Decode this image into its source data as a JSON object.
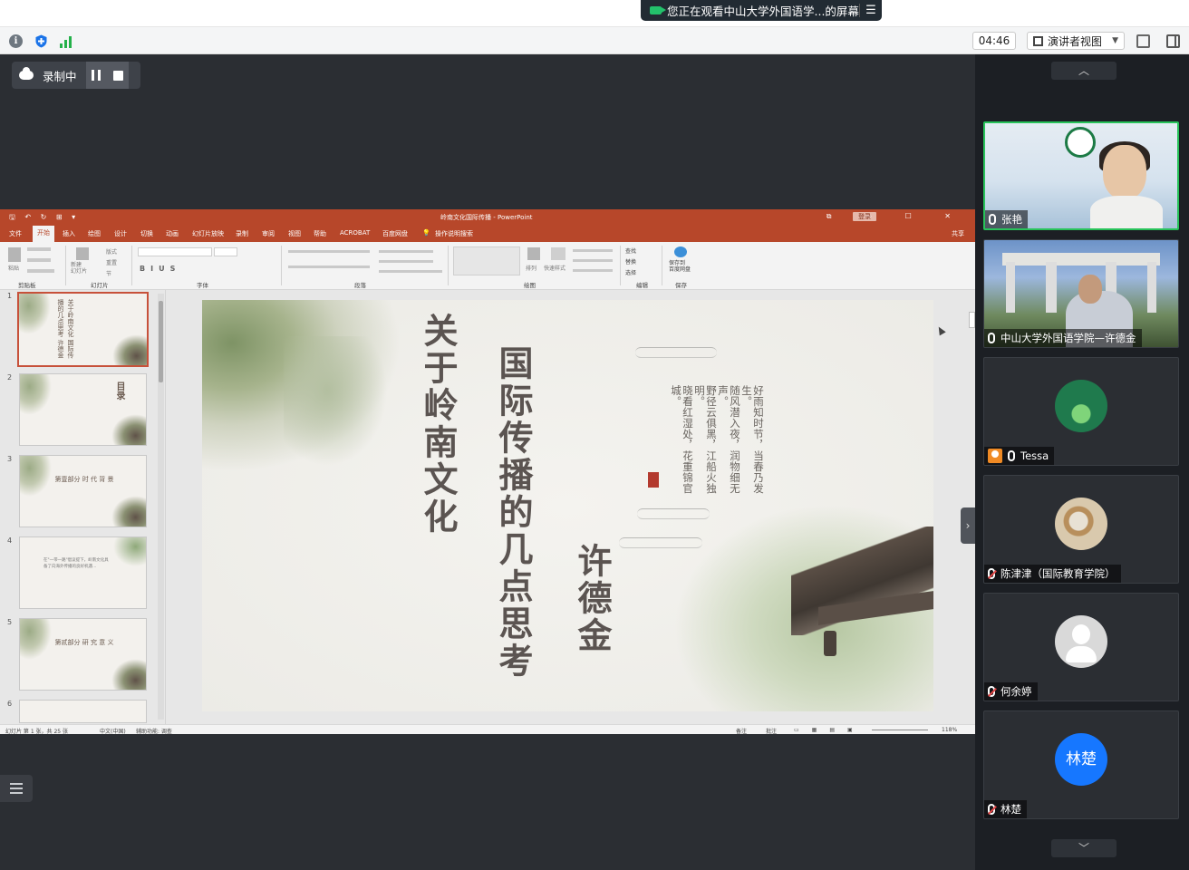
{
  "share_banner": {
    "text": "您正在观看中山大学外国语学...的屏幕"
  },
  "toolbar": {
    "timer": "04:46",
    "view_mode": "演讲者视图"
  },
  "recording": {
    "label": "录制中"
  },
  "powerpoint": {
    "doc_title": "岭南文化国际传播 - PowerPoint",
    "login": "登录",
    "tabs": [
      "文件",
      "开始",
      "插入",
      "绘图",
      "设计",
      "切换",
      "动画",
      "幻灯片放映",
      "录制",
      "审阅",
      "视图",
      "帮助",
      "ACROBAT",
      "百度网盘"
    ],
    "active_tab": "开始",
    "tell_me": "操作说明搜索",
    "share": "共享",
    "groups": [
      "剪贴板",
      "幻灯片",
      "字体",
      "段落",
      "绘图",
      "编辑",
      "保存"
    ],
    "ribbon_labels": {
      "paste": "粘贴",
      "new_slide": "新建\n幻灯片",
      "layout": "版式",
      "reset": "重置",
      "section": "节",
      "find": "查找",
      "replace": "替换",
      "select": "选择",
      "arrange": "排列",
      "quick_styles": "快速样式",
      "save_baidu": "保存到\n百度网盘"
    },
    "thumbnails": [
      {
        "num": "1",
        "text": "关于岭南文化 国际传播的几点思考 许德金"
      },
      {
        "num": "2",
        "text": "目录"
      },
      {
        "num": "3",
        "text": "第壹部分  时 代 背 景"
      },
      {
        "num": "4",
        "text": "在\"一带一路\"倡议提下，岭南文化具备了向海外传播的良好机遇…"
      },
      {
        "num": "5",
        "text": "第贰部分  研 究 意 义"
      },
      {
        "num": "6",
        "text": ""
      }
    ],
    "slide": {
      "title_a": "关于岭南文化",
      "title_b": "国际传播的几点思考",
      "author": "许德金",
      "poem": [
        "好雨知时节，当春乃发生。",
        "随风潜入夜，润物细无声。",
        "野径云俱黑，江船火独明。",
        "晓看红湿处，花重锦官城。"
      ]
    },
    "status": {
      "slide_info": "幻灯片 第 1 张，共 25 张",
      "language": "中文(中国)",
      "accessibility": "辅助功能: 调查",
      "notes": "备注",
      "comments": "批注",
      "zoom": "118%"
    }
  },
  "participants": [
    {
      "name": "张艳",
      "mic": "on",
      "speaking": true,
      "kind": "video"
    },
    {
      "name": "中山大学外国语学院—许德金",
      "mic": "on",
      "speaking": false,
      "kind": "video"
    },
    {
      "name": "Tessa",
      "mic": "on",
      "speaking": false,
      "kind": "avatar-green",
      "host": true
    },
    {
      "name": "陈津津（国际教育学院）",
      "mic": "off",
      "speaking": false,
      "kind": "avatar-photo"
    },
    {
      "name": "何余婷",
      "mic": "off",
      "speaking": false,
      "kind": "avatar-gray"
    },
    {
      "name": "林楚",
      "mic": "off",
      "speaking": false,
      "kind": "avatar-blue",
      "initials": "林楚"
    }
  ],
  "colors": {
    "ppt_accent": "#b7472a",
    "speaking_border": "#28c35a",
    "avatar_blue": "#1677ff"
  }
}
